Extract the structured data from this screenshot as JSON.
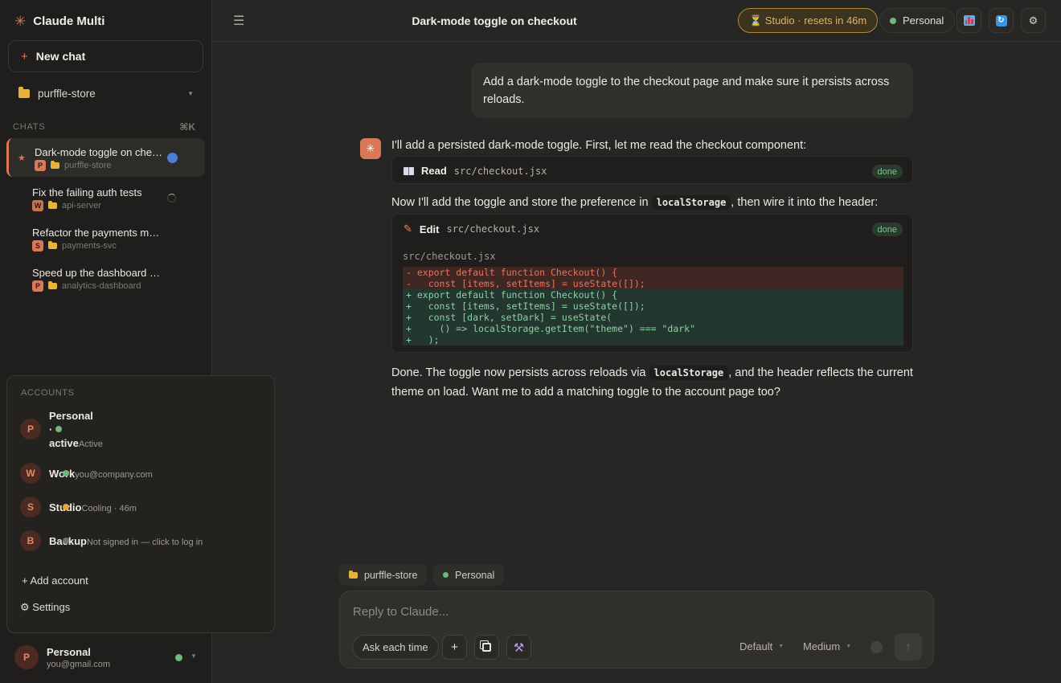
{
  "app": {
    "name": "Claude Multi",
    "logo_icon": "asterisk-icon"
  },
  "sidebar": {
    "new_chat_label": "New chat",
    "project": "purffle-store",
    "chats_label": "CHATS",
    "chats_shortcut": "⌘K",
    "chats": [
      {
        "title": "Dark-mode toggle on che…",
        "badge": "P",
        "project": "purffle-store",
        "active": true,
        "status": "unread"
      },
      {
        "title": "Fix the failing auth tests",
        "badge": "W",
        "project": "api-server",
        "active": false,
        "status": "running"
      },
      {
        "title": "Refactor the payments m…",
        "badge": "S",
        "project": "payments-svc",
        "active": false,
        "status": ""
      },
      {
        "title": "Speed up the dashboard …",
        "badge": "P",
        "project": "analytics-dashboard",
        "active": false,
        "status": ""
      }
    ]
  },
  "accounts_menu": {
    "heading": "ACCOUNTS",
    "accounts": [
      {
        "initial": "P",
        "name": "Personal",
        "name_line2": "·",
        "name_line3": "active",
        "detail": "Active",
        "status_color": "#6fb87f"
      },
      {
        "initial": "W",
        "name": "Work",
        "detail": "you@company.com",
        "status_color": "#6fb87f"
      },
      {
        "initial": "S",
        "name": "Studio",
        "detail": "Cooling · 46m",
        "status_color": "#e2a842"
      },
      {
        "initial": "B",
        "name": "Backup",
        "detail": "Not signed in — click to log in",
        "status_color": "#77746e"
      }
    ],
    "add_account_label": "+ Add account",
    "settings_label": "⚙ Settings"
  },
  "current_user": {
    "initial": "P",
    "name": "Personal",
    "email": "you@gmail.com"
  },
  "topbar": {
    "title": "Dark-mode toggle on checkout",
    "studio_pill": "⏳ Studio · resets in 46m",
    "account_pill": "Personal"
  },
  "conversation": {
    "user_message": "Add a dark-mode toggle to the checkout page and make sure it persists across reloads.",
    "para1": "I'll add a persisted dark-mode toggle. First, let me read the checkout component:",
    "tool1": {
      "action": "Read",
      "path": "src/checkout.jsx",
      "status": "done"
    },
    "para2_a": "Now I'll add the toggle and store the preference in ",
    "para2_code": "localStorage",
    "para2_b": ", then wire it into the header:",
    "tool2": {
      "action": "Edit",
      "path": "src/checkout.jsx",
      "status": "done",
      "diff_file": "src/checkout.jsx",
      "diff": [
        {
          "kind": "del",
          "text": "- export default function Checkout() {"
        },
        {
          "kind": "del",
          "text": "-   const [items, setItems] = useState([]);"
        },
        {
          "kind": "add",
          "text": "+ export default function Checkout() {"
        },
        {
          "kind": "add",
          "text": "+   const [items, setItems] = useState([]);"
        },
        {
          "kind": "add",
          "text": "+   const [dark, setDark] = useState("
        },
        {
          "kind": "add",
          "text": "+     () => localStorage.getItem(\"theme\") === \"dark\""
        },
        {
          "kind": "add",
          "text": "+   );"
        }
      ]
    },
    "para3_a": "Done. The toggle now persists across reloads via ",
    "para3_code": "localStorage",
    "para3_b": ", and the header reflects the current theme on load. Want me to add a matching toggle to the account page too?"
  },
  "composer": {
    "context_project": "purffle-store",
    "context_account": "Personal",
    "placeholder": "Reply to Claude...",
    "permission_mode": "Ask each time",
    "model": "Default",
    "effort": "Medium",
    "add_icon": "+",
    "send_icon": "↑"
  }
}
